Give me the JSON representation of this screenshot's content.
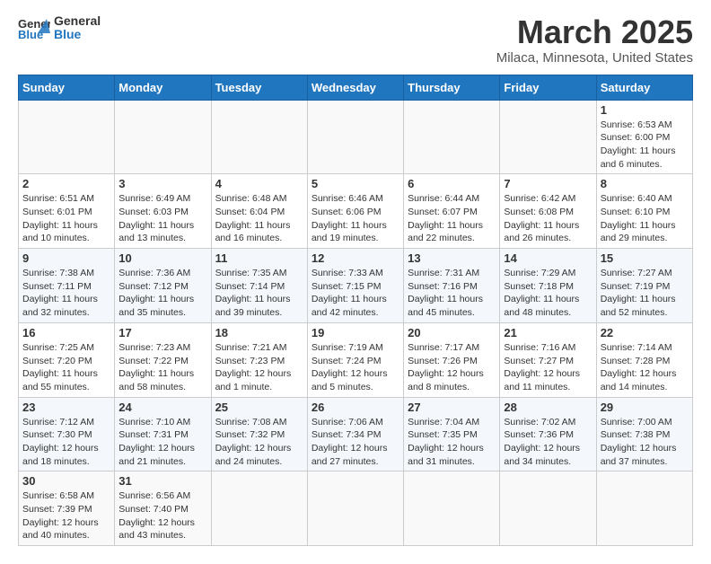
{
  "header": {
    "logo_general": "General",
    "logo_blue": "Blue",
    "month_title": "March 2025",
    "location": "Milaca, Minnesota, United States"
  },
  "weekdays": [
    "Sunday",
    "Monday",
    "Tuesday",
    "Wednesday",
    "Thursday",
    "Friday",
    "Saturday"
  ],
  "weeks": [
    [
      {
        "day": "",
        "info": ""
      },
      {
        "day": "",
        "info": ""
      },
      {
        "day": "",
        "info": ""
      },
      {
        "day": "",
        "info": ""
      },
      {
        "day": "",
        "info": ""
      },
      {
        "day": "",
        "info": ""
      },
      {
        "day": "1",
        "info": "Sunrise: 6:53 AM\nSunset: 6:00 PM\nDaylight: 11 hours\nand 6 minutes."
      }
    ],
    [
      {
        "day": "2",
        "info": "Sunrise: 6:51 AM\nSunset: 6:01 PM\nDaylight: 11 hours\nand 10 minutes."
      },
      {
        "day": "3",
        "info": "Sunrise: 6:49 AM\nSunset: 6:03 PM\nDaylight: 11 hours\nand 13 minutes."
      },
      {
        "day": "4",
        "info": "Sunrise: 6:48 AM\nSunset: 6:04 PM\nDaylight: 11 hours\nand 16 minutes."
      },
      {
        "day": "5",
        "info": "Sunrise: 6:46 AM\nSunset: 6:06 PM\nDaylight: 11 hours\nand 19 minutes."
      },
      {
        "day": "6",
        "info": "Sunrise: 6:44 AM\nSunset: 6:07 PM\nDaylight: 11 hours\nand 22 minutes."
      },
      {
        "day": "7",
        "info": "Sunrise: 6:42 AM\nSunset: 6:08 PM\nDaylight: 11 hours\nand 26 minutes."
      },
      {
        "day": "8",
        "info": "Sunrise: 6:40 AM\nSunset: 6:10 PM\nDaylight: 11 hours\nand 29 minutes."
      }
    ],
    [
      {
        "day": "9",
        "info": "Sunrise: 7:38 AM\nSunset: 7:11 PM\nDaylight: 11 hours\nand 32 minutes."
      },
      {
        "day": "10",
        "info": "Sunrise: 7:36 AM\nSunset: 7:12 PM\nDaylight: 11 hours\nand 35 minutes."
      },
      {
        "day": "11",
        "info": "Sunrise: 7:35 AM\nSunset: 7:14 PM\nDaylight: 11 hours\nand 39 minutes."
      },
      {
        "day": "12",
        "info": "Sunrise: 7:33 AM\nSunset: 7:15 PM\nDaylight: 11 hours\nand 42 minutes."
      },
      {
        "day": "13",
        "info": "Sunrise: 7:31 AM\nSunset: 7:16 PM\nDaylight: 11 hours\nand 45 minutes."
      },
      {
        "day": "14",
        "info": "Sunrise: 7:29 AM\nSunset: 7:18 PM\nDaylight: 11 hours\nand 48 minutes."
      },
      {
        "day": "15",
        "info": "Sunrise: 7:27 AM\nSunset: 7:19 PM\nDaylight: 11 hours\nand 52 minutes."
      }
    ],
    [
      {
        "day": "16",
        "info": "Sunrise: 7:25 AM\nSunset: 7:20 PM\nDaylight: 11 hours\nand 55 minutes."
      },
      {
        "day": "17",
        "info": "Sunrise: 7:23 AM\nSunset: 7:22 PM\nDaylight: 11 hours\nand 58 minutes."
      },
      {
        "day": "18",
        "info": "Sunrise: 7:21 AM\nSunset: 7:23 PM\nDaylight: 12 hours\nand 1 minute."
      },
      {
        "day": "19",
        "info": "Sunrise: 7:19 AM\nSunset: 7:24 PM\nDaylight: 12 hours\nand 5 minutes."
      },
      {
        "day": "20",
        "info": "Sunrise: 7:17 AM\nSunset: 7:26 PM\nDaylight: 12 hours\nand 8 minutes."
      },
      {
        "day": "21",
        "info": "Sunrise: 7:16 AM\nSunset: 7:27 PM\nDaylight: 12 hours\nand 11 minutes."
      },
      {
        "day": "22",
        "info": "Sunrise: 7:14 AM\nSunset: 7:28 PM\nDaylight: 12 hours\nand 14 minutes."
      }
    ],
    [
      {
        "day": "23",
        "info": "Sunrise: 7:12 AM\nSunset: 7:30 PM\nDaylight: 12 hours\nand 18 minutes."
      },
      {
        "day": "24",
        "info": "Sunrise: 7:10 AM\nSunset: 7:31 PM\nDaylight: 12 hours\nand 21 minutes."
      },
      {
        "day": "25",
        "info": "Sunrise: 7:08 AM\nSunset: 7:32 PM\nDaylight: 12 hours\nand 24 minutes."
      },
      {
        "day": "26",
        "info": "Sunrise: 7:06 AM\nSunset: 7:34 PM\nDaylight: 12 hours\nand 27 minutes."
      },
      {
        "day": "27",
        "info": "Sunrise: 7:04 AM\nSunset: 7:35 PM\nDaylight: 12 hours\nand 31 minutes."
      },
      {
        "day": "28",
        "info": "Sunrise: 7:02 AM\nSunset: 7:36 PM\nDaylight: 12 hours\nand 34 minutes."
      },
      {
        "day": "29",
        "info": "Sunrise: 7:00 AM\nSunset: 7:38 PM\nDaylight: 12 hours\nand 37 minutes."
      }
    ],
    [
      {
        "day": "30",
        "info": "Sunrise: 6:58 AM\nSunset: 7:39 PM\nDaylight: 12 hours\nand 40 minutes."
      },
      {
        "day": "31",
        "info": "Sunrise: 6:56 AM\nSunset: 7:40 PM\nDaylight: 12 hours\nand 43 minutes."
      },
      {
        "day": "",
        "info": ""
      },
      {
        "day": "",
        "info": ""
      },
      {
        "day": "",
        "info": ""
      },
      {
        "day": "",
        "info": ""
      },
      {
        "day": "",
        "info": ""
      }
    ]
  ]
}
